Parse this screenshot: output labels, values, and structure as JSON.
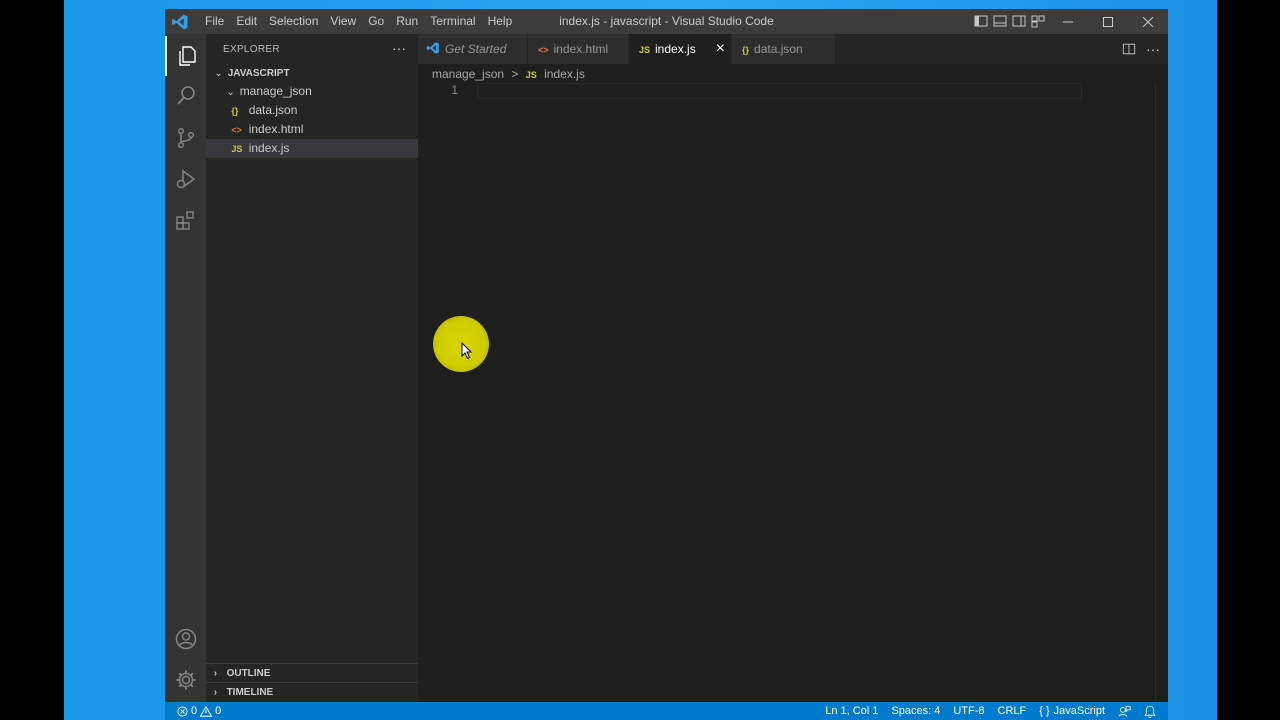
{
  "window": {
    "title": "index.js - javascript - Visual Studio Code",
    "menu": [
      "File",
      "Edit",
      "Selection",
      "View",
      "Go",
      "Run",
      "Terminal",
      "Help"
    ]
  },
  "activity_bar": {
    "items": [
      "explorer-icon",
      "search-icon",
      "source-control-icon",
      "run-debug-icon",
      "extensions-icon"
    ],
    "bottom": [
      "account-icon",
      "settings-gear-icon"
    ]
  },
  "sidebar": {
    "title": "EXPLORER",
    "more": "···",
    "root": "JAVASCRIPT",
    "folder": "manage_json",
    "files": [
      {
        "icon": "{}",
        "name": "data.json"
      },
      {
        "icon": "<>",
        "name": "index.html"
      },
      {
        "icon": "JS",
        "name": "index.js"
      }
    ],
    "outline": "OUTLINE",
    "timeline": "TIMELINE"
  },
  "tabs": [
    {
      "icon": "vscode-icon",
      "label": "Get Started"
    },
    {
      "icon": "<>",
      "label": "index.html"
    },
    {
      "icon": "JS",
      "label": "index.js",
      "close": "×"
    },
    {
      "icon": "{}",
      "label": "data.json"
    }
  ],
  "breadcrumb": {
    "folder": "manage_json",
    "sep": ">",
    "icon": "JS",
    "file": "index.js"
  },
  "editor": {
    "line_numbers": [
      "1"
    ]
  },
  "statusbar": {
    "errors": "0",
    "warnings": "0",
    "position": "Ln 1, Col 1",
    "spaces": "Spaces: 4",
    "encoding": "UTF-8",
    "eol": "CRLF",
    "language_icon": "{ }",
    "language": "JavaScript"
  },
  "colors": {
    "accent": "#007acc",
    "json_icon": "#cbcb41",
    "html_icon": "#e37933",
    "cursor_highlight": "#d8d400"
  }
}
